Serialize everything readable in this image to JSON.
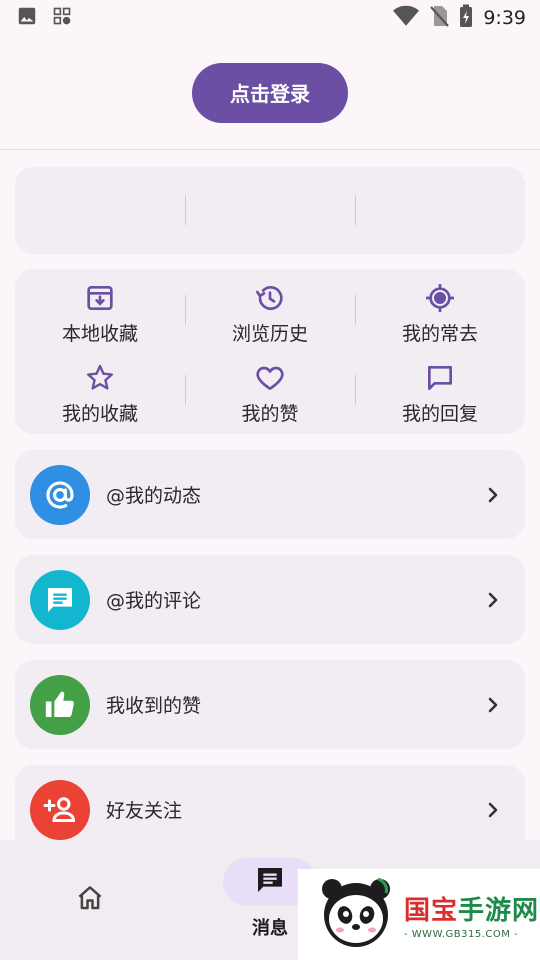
{
  "status_bar": {
    "time": "9:39"
  },
  "header": {
    "login_label": "点击登录"
  },
  "grid": {
    "row1": [
      {
        "label": "本地收藏",
        "icon": "archive-download-icon"
      },
      {
        "label": "浏览历史",
        "icon": "history-icon"
      },
      {
        "label": "我的常去",
        "icon": "location-target-icon"
      }
    ],
    "row2": [
      {
        "label": "我的收藏",
        "icon": "star-icon"
      },
      {
        "label": "我的赞",
        "icon": "heart-icon"
      },
      {
        "label": "我的回复",
        "icon": "comment-icon"
      }
    ],
    "icon_color": "#6a4fa4"
  },
  "list": [
    {
      "label": "@我的动态",
      "icon": "at-sign-icon",
      "color": "#2f8fe3"
    },
    {
      "label": "@我的评论",
      "icon": "comment-lines-icon",
      "color": "#12b7cf"
    },
    {
      "label": "我收到的赞",
      "icon": "thumbs-up-icon",
      "color": "#43a047"
    },
    {
      "label": "好友关注",
      "icon": "person-add-icon",
      "color": "#ea4335"
    }
  ],
  "bottom_nav": {
    "messages_label": "消息"
  },
  "watermark": {
    "brand_red": "国宝",
    "brand_green": "手游网",
    "url": "- WWW.GB315.COM -"
  }
}
